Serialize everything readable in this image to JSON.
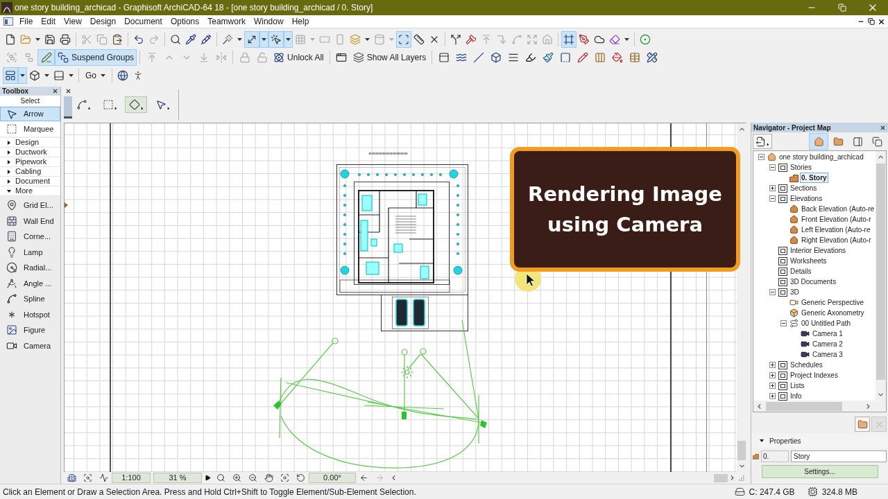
{
  "title_bar": {
    "title": "one story building_archicad - Graphisoft ArchiCAD-64 18 - [one story building_archicad / 0. Story]"
  },
  "menu_bar": {
    "items": [
      "File",
      "Edit",
      "View",
      "Design",
      "Document",
      "Options",
      "Teamwork",
      "Window",
      "Help"
    ]
  },
  "toolbars": [
    {
      "groups": [
        [
          {
            "kind": "icon",
            "on": false,
            "disabled": false
          },
          {
            "kind": "split",
            "on": false,
            "disabled": false
          },
          {
            "kind": "icon",
            "on": false,
            "disabled": false
          },
          {
            "kind": "icon",
            "on": false,
            "disabled": false
          }
        ],
        [
          {
            "kind": "icon",
            "on": false,
            "disabled": true
          },
          {
            "kind": "icon",
            "on": false,
            "disabled": true
          },
          {
            "kind": "icon",
            "on": false,
            "disabled": false
          }
        ],
        [
          {
            "kind": "icon",
            "on": false,
            "disabled": false
          },
          {
            "kind": "icon",
            "on": false,
            "disabled": true
          }
        ],
        [
          {
            "kind": "icon",
            "on": false,
            "disabled": false
          },
          {
            "kind": "icon",
            "on": false,
            "disabled": false
          },
          {
            "kind": "icon",
            "on": false,
            "disabled": false
          }
        ],
        [
          {
            "kind": "split",
            "on": false,
            "disabled": false
          },
          {
            "kind": "split",
            "on": true,
            "disabled": false
          },
          {
            "kind": "split",
            "on": true,
            "disabled": false
          },
          {
            "kind": "split",
            "on": false,
            "disabled": true
          },
          {
            "kind": "icon",
            "on": false,
            "disabled": true
          },
          {
            "kind": "icon",
            "on": false,
            "disabled": true
          },
          {
            "kind": "split",
            "on": false,
            "disabled": false
          },
          {
            "kind": "split",
            "on": false,
            "disabled": true
          },
          {
            "kind": "icon",
            "on": true,
            "disabled": false
          },
          {
            "kind": "icon",
            "on": false,
            "disabled": false
          },
          {
            "kind": "icon",
            "on": false,
            "disabled": false
          }
        ],
        [
          {
            "kind": "icon",
            "on": false,
            "disabled": false
          },
          {
            "kind": "icon",
            "on": false,
            "disabled": false
          },
          {
            "kind": "icon",
            "on": false,
            "disabled": true
          },
          {
            "kind": "icon",
            "on": false,
            "disabled": true
          },
          {
            "kind": "icon",
            "on": false,
            "disabled": true
          },
          {
            "kind": "icon",
            "on": false,
            "disabled": true
          },
          {
            "kind": "icon",
            "on": false,
            "disabled": true
          }
        ],
        [
          {
            "kind": "icon",
            "on": true,
            "disabled": false
          },
          {
            "kind": "icon",
            "on": false,
            "disabled": false
          },
          {
            "kind": "icon",
            "on": false,
            "disabled": false
          },
          {
            "kind": "split",
            "on": false,
            "disabled": false
          }
        ],
        [
          {
            "kind": "icon",
            "on": false,
            "disabled": false
          }
        ]
      ]
    },
    {
      "groups": [
        [
          {
            "kind": "icon",
            "on": false,
            "disabled": true
          },
          {
            "kind": "icon",
            "on": false,
            "disabled": true
          },
          {
            "kind": "icon",
            "on": true,
            "disabled": false
          },
          {
            "kind": "text",
            "label": "Suspend Groups",
            "on": true,
            "disabled": false
          }
        ],
        [
          {
            "kind": "icon",
            "on": false,
            "disabled": true
          },
          {
            "kind": "icon",
            "on": false,
            "disabled": true
          },
          {
            "kind": "icon",
            "on": false,
            "disabled": true
          },
          {
            "kind": "icon",
            "on": false,
            "disabled": true
          },
          {
            "kind": "icon",
            "on": false,
            "disabled": true
          }
        ],
        [
          {
            "kind": "icon",
            "on": false,
            "disabled": true
          },
          {
            "kind": "icon",
            "on": false,
            "disabled": true
          },
          {
            "kind": "text",
            "label": "Unlock All",
            "on": false,
            "disabled": false
          }
        ],
        [
          {
            "kind": "icon",
            "on": false,
            "disabled": false
          },
          {
            "kind": "text",
            "label": "Show All Layers",
            "on": false,
            "disabled": false
          }
        ],
        [
          {
            "kind": "icon",
            "on": false,
            "disabled": false
          },
          {
            "kind": "icon",
            "on": false,
            "disabled": false
          },
          {
            "kind": "icon",
            "on": false,
            "disabled": false
          },
          {
            "kind": "icon",
            "on": false,
            "disabled": false
          },
          {
            "kind": "icon",
            "on": false,
            "disabled": false
          },
          {
            "kind": "icon",
            "on": false,
            "disabled": false
          },
          {
            "kind": "icon",
            "on": false,
            "disabled": false
          },
          {
            "kind": "icon",
            "on": false,
            "disabled": false
          },
          {
            "kind": "icon",
            "on": false,
            "disabled": false
          },
          {
            "kind": "icon",
            "on": false,
            "disabled": false
          },
          {
            "kind": "icon",
            "on": false,
            "disabled": false
          },
          {
            "kind": "icon",
            "on": false,
            "disabled": false
          },
          {
            "kind": "icon",
            "on": false,
            "disabled": false
          }
        ]
      ]
    },
    {
      "groups": [
        [
          {
            "kind": "split",
            "on": true,
            "disabled": false
          },
          {
            "kind": "split",
            "on": false,
            "disabled": false
          },
          {
            "kind": "split",
            "on": false,
            "disabled": false
          }
        ],
        [
          {
            "kind": "menu",
            "label": "Go",
            "on": false,
            "disabled": false
          }
        ],
        [
          {
            "kind": "icon",
            "on": false,
            "disabled": false
          },
          {
            "kind": "icon",
            "on": false,
            "disabled": false
          }
        ]
      ]
    }
  ],
  "toolbox": {
    "title": "Toolbox",
    "heading": "Select",
    "select_tools": [
      {
        "label": "Arrow",
        "selected": true
      },
      {
        "label": "Marquee",
        "selected": false
      }
    ],
    "groups": [
      {
        "label": "Design",
        "expanded": false
      },
      {
        "label": "Ductwork",
        "expanded": false
      },
      {
        "label": "Pipework",
        "expanded": false
      },
      {
        "label": "Cabling",
        "expanded": false
      },
      {
        "label": "Document",
        "expanded": false
      },
      {
        "label": "More",
        "expanded": true,
        "tools": [
          {
            "label": "Grid El...",
            "selected": false
          },
          {
            "label": "Wall End",
            "selected": false
          },
          {
            "label": "Corne...",
            "selected": false
          },
          {
            "label": "Lamp",
            "selected": false
          },
          {
            "label": "Radial...",
            "selected": false
          },
          {
            "label": "Angle ...",
            "selected": false
          },
          {
            "label": "Spline",
            "selected": false
          },
          {
            "label": "Hotspot",
            "selected": false
          },
          {
            "label": "Figure",
            "selected": false
          },
          {
            "label": "Camera",
            "selected": false
          }
        ]
      }
    ]
  },
  "info_box": {
    "methods": [
      {
        "selected": false
      },
      {
        "selected": false
      },
      {
        "selected": true
      },
      {
        "selected": false
      }
    ]
  },
  "overlay": {
    "caption": "Rendering Image using Camera"
  },
  "canvas_toolbar": {
    "scale": "1:100",
    "zoom": "31 %",
    "angle": "0.00°",
    "next_zoom": {
      "disabled": true
    }
  },
  "navigator": {
    "title": "Navigator - Project Map",
    "view_buttons": [
      {
        "selected": true
      },
      {
        "selected": false
      },
      {
        "selected": false
      },
      {
        "selected": false
      }
    ],
    "tree": [
      {
        "label": "one story building_archicad",
        "kind": "project",
        "expanded": true,
        "selected": false,
        "children": [
          {
            "label": "Stories",
            "kind": "folder",
            "expanded": true,
            "selected": false,
            "children": [
              {
                "label": "0. Story",
                "kind": "story",
                "selected": true
              }
            ]
          },
          {
            "label": "Sections",
            "kind": "folder",
            "expanded": false,
            "selected": false
          },
          {
            "label": "Elevations",
            "kind": "folder",
            "expanded": true,
            "selected": false,
            "children": [
              {
                "label": "Back Elevation (Auto-re",
                "kind": "elevation",
                "selected": false
              },
              {
                "label": "Front Elevation (Auto-r",
                "kind": "elevation",
                "selected": false
              },
              {
                "label": "Left Elevation (Auto-re",
                "kind": "elevation",
                "selected": false
              },
              {
                "label": "Right Elevation (Auto-r",
                "kind": "elevation",
                "selected": false
              }
            ]
          },
          {
            "label": "Interior Elevations",
            "kind": "folder",
            "selected": false
          },
          {
            "label": "Worksheets",
            "kind": "folder",
            "selected": false
          },
          {
            "label": "Details",
            "kind": "folder",
            "selected": false
          },
          {
            "label": "3D Documents",
            "kind": "folder",
            "selected": false
          },
          {
            "label": "3D",
            "kind": "folder",
            "expanded": true,
            "selected": false,
            "children": [
              {
                "label": "Generic Perspective",
                "kind": "perspective",
                "selected": false
              },
              {
                "label": "Generic Axonometry",
                "kind": "axonometry",
                "selected": false
              },
              {
                "label": "00 Untitled Path",
                "kind": "path",
                "expanded": true,
                "selected": false,
                "children": [
                  {
                    "label": "Camera 1",
                    "kind": "camera",
                    "selected": false
                  },
                  {
                    "label": "Camera 2",
                    "kind": "camera",
                    "selected": false
                  },
                  {
                    "label": "Camera 3",
                    "kind": "camera",
                    "selected": false
                  }
                ]
              }
            ]
          },
          {
            "label": "Schedules",
            "kind": "folder",
            "expanded": false,
            "selected": false
          },
          {
            "label": "Project Indexes",
            "kind": "folder",
            "expanded": false,
            "selected": false
          },
          {
            "label": "Lists",
            "kind": "folder",
            "expanded": false,
            "selected": false
          },
          {
            "label": "Info",
            "kind": "folder",
            "expanded": false,
            "selected": false
          }
        ]
      }
    ],
    "actions": [
      {
        "disabled": false
      },
      {
        "disabled": true
      }
    ],
    "properties": {
      "label": "Properties",
      "expanded": true,
      "number": "0.",
      "name": "Story",
      "button": "Settings..."
    }
  },
  "status_bar": {
    "message": "Click an Element or Draw a Selection Area. Press and Hold Ctrl+Shift to Toggle Element/Sub-Element Selection.",
    "disk": "C: 247.4 GB",
    "memory": "324.8 MB"
  }
}
